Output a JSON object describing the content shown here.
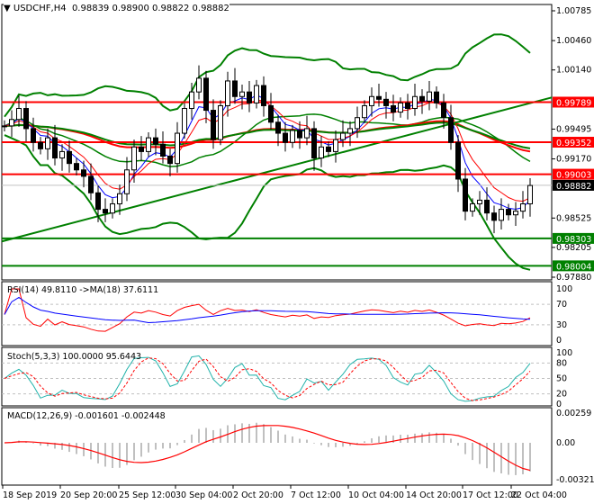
{
  "header": {
    "symbol": "USDCHF,H4",
    "ohlc": "0.98839 0.98900 0.98822 0.98882"
  },
  "chart_data": {
    "type": "candlestick",
    "symbol": "USDCHF",
    "timeframe": "H4",
    "closes": [
      0.9953,
      0.996,
      0.9972,
      0.995,
      0.9935,
      0.9928,
      0.994,
      0.9918,
      0.9925,
      0.9912,
      0.9905,
      0.9898,
      0.988,
      0.9862,
      0.9858,
      0.9868,
      0.9879,
      0.9905,
      0.993,
      0.9925,
      0.994,
      0.9933,
      0.992,
      0.9912,
      0.9945,
      0.9972,
      0.999,
      1.0005,
      0.997,
      0.9938,
      0.9975,
      1.0002,
      0.9985,
      0.999,
      0.9978,
      0.9997,
      0.9975,
      0.9957,
      0.9945,
      0.9935,
      0.9948,
      0.994,
      0.995,
      0.9918,
      0.993,
      0.9925,
      0.9938,
      0.9945,
      0.995,
      0.9962,
      0.9975,
      0.9985,
      0.9982,
      0.9975,
      0.9968,
      0.9978,
      0.9972,
      0.9985,
      0.998,
      0.999,
      0.9978,
      0.9962,
      0.9935,
      0.9895,
      0.986,
      0.9868,
      0.9872,
      0.9858,
      0.985,
      0.9862,
      0.9856,
      0.986,
      0.9868,
      0.9888
    ],
    "price_ticks": [
      "1.00785",
      "1.00460",
      "1.00140",
      "0.99495",
      "0.99170",
      "0.98525",
      "0.98205",
      "0.97880"
    ],
    "ylim": [
      0.9788,
      1.00785
    ],
    "resistance_levels": [
      "0.99789",
      "0.99352",
      "0.99003"
    ],
    "support_levels": [
      "0.98303",
      "0.98004"
    ],
    "current_price": "0.98882",
    "trendline": [
      0.9827,
      0.9984
    ],
    "time_labels": [
      "18 Sep 2019",
      "20 Sep 20:00",
      "25 Sep 12:00",
      "30 Sep 04:00",
      "2 Oct 20:00",
      "7 Oct 12:00",
      "10 Oct 04:00",
      "14 Oct 20:00",
      "17 Oct 12:00",
      "22 Oct 04:00"
    ],
    "rsi": {
      "label": "RSI(14) 49.8110  ->MA(18) 37.6111",
      "ticks": [
        "100",
        "70",
        "30",
        "0"
      ]
    },
    "stoch": {
      "label": "Stoch(5,3,3) 100.0000 95.6443",
      "ticks": [
        "100",
        "80",
        "50",
        "20",
        "0"
      ]
    },
    "macd": {
      "label": "MACD(12,26,9) -0.001601 -0.002448",
      "ticks": [
        "0.00259",
        "0.00",
        "-0.003217"
      ]
    },
    "colors": {
      "bull": "#000000",
      "resistance": "#ff0000",
      "support": "#008000",
      "bands": "#008000",
      "rsi": "#ff0000",
      "rsi_ma": "#0000ff",
      "stoch_main": "#20b2aa",
      "stoch_signal": "#ff0000",
      "macd_hist": "#c0c0c0",
      "macd_signal": "#ff0000"
    }
  }
}
